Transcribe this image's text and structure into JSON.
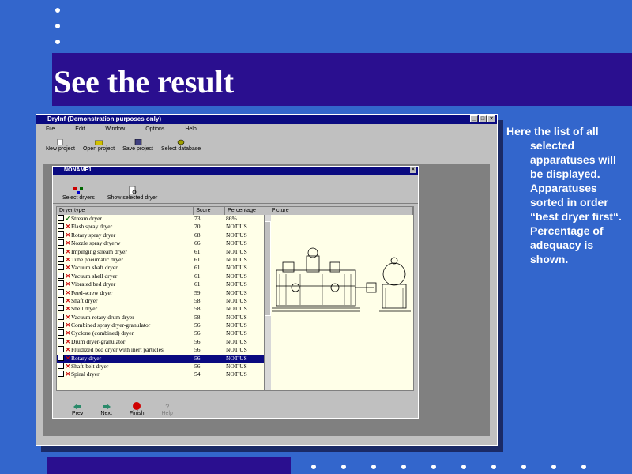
{
  "slide": {
    "title": "See the result",
    "side_text": {
      "first": "Here the list of all",
      "rest": "selected apparatuses will be displayed. Apparatuses sorted in order “best dryer first“. Percentage of adequacy is shown."
    }
  },
  "app": {
    "window_title": "DryInf (Demonstration purposes only)",
    "menu": [
      "File",
      "Edit",
      "Window",
      "Options",
      "Help"
    ],
    "toolbar": [
      "New project",
      "Open project",
      "Save project",
      "Select database"
    ],
    "child_title": "NONAME1",
    "child_toolbar": [
      "Select dryers",
      "Show selected dryer"
    ],
    "columns": [
      "Dryer type",
      "Score",
      "Percentage",
      "Picture"
    ],
    "rows": [
      {
        "name": "Stream dryer",
        "score": "73",
        "pct": "86%",
        "mark": "check"
      },
      {
        "name": "Flash spray dryer",
        "score": "70",
        "pct": "NOT US",
        "mark": "x"
      },
      {
        "name": "Rotary spray dryer",
        "score": "68",
        "pct": "NOT US",
        "mark": "x"
      },
      {
        "name": "Nozzle spray dryerw",
        "score": "66",
        "pct": "NOT US",
        "mark": "x"
      },
      {
        "name": "Impinging stream dryer",
        "score": "61",
        "pct": "NOT US",
        "mark": "x"
      },
      {
        "name": "Tube pneumatic dryer",
        "score": "61",
        "pct": "NOT US",
        "mark": "x"
      },
      {
        "name": "Vacuum shaft dryer",
        "score": "61",
        "pct": "NOT US",
        "mark": "x"
      },
      {
        "name": "Vacuum shell dryer",
        "score": "61",
        "pct": "NOT US",
        "mark": "x"
      },
      {
        "name": "Vibrated bed dryer",
        "score": "61",
        "pct": "NOT US",
        "mark": "x"
      },
      {
        "name": "Feed-screw dryer",
        "score": "59",
        "pct": "NOT US",
        "mark": "x"
      },
      {
        "name": "Shaft dryer",
        "score": "58",
        "pct": "NOT US",
        "mark": "x"
      },
      {
        "name": "Shell dryer",
        "score": "58",
        "pct": "NOT US",
        "mark": "x"
      },
      {
        "name": "Vacuum rotary drum dryer",
        "score": "58",
        "pct": "NOT US",
        "mark": "x"
      },
      {
        "name": "Combined spray dryer-granulator",
        "score": "56",
        "pct": "NOT US",
        "mark": "x"
      },
      {
        "name": "Cyclone (combined) dryer",
        "score": "56",
        "pct": "NOT US",
        "mark": "x"
      },
      {
        "name": "Drum dryer-granulator",
        "score": "56",
        "pct": "NOT US",
        "mark": "x"
      },
      {
        "name": "Fluidized bed dryer with inert particles",
        "score": "56",
        "pct": "NOT US",
        "mark": "x"
      },
      {
        "name": "Rotary dryer",
        "score": "56",
        "pct": "NOT US",
        "mark": "x",
        "selected": true
      },
      {
        "name": "Shaft-belt dryer",
        "score": "56",
        "pct": "NOT US",
        "mark": "x"
      },
      {
        "name": "Spiral dryer",
        "score": "54",
        "pct": "NOT US",
        "mark": "x"
      }
    ],
    "bottom_buttons": [
      "Prev",
      "Next",
      "Finish",
      "Help"
    ]
  },
  "colors": {
    "background": "#3366cc",
    "band": "#2a0f8f",
    "titlebar": "#0a0a80"
  }
}
